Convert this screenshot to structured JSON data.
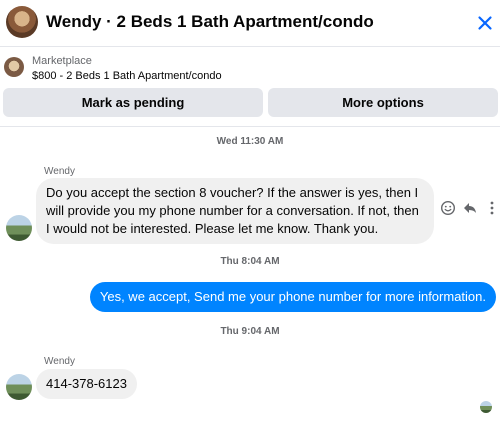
{
  "header": {
    "title": "Wendy · 2 Beds 1 Bath Apartment/condo"
  },
  "marketplace": {
    "label": "Marketplace",
    "listing": "$800 - 2 Beds 1 Bath Apartment/condo",
    "mark_pending_label": "Mark as pending",
    "more_options_label": "More options"
  },
  "conversation": {
    "timestamp_1": "Wed 11:30 AM",
    "sender_1": "Wendy",
    "message_1": "Do you accept the section 8 voucher? If the answer is yes, then I will provide you my phone number for a conversation. If not, then I would not be interested. Please let me know. Thank you.",
    "timestamp_2": "Thu 8:04 AM",
    "message_2": "Yes, we accept, Send me your phone number for more information.",
    "timestamp_3": "Thu 9:04 AM",
    "sender_3": "Wendy",
    "message_3": "414-378-6123"
  },
  "icons": {
    "close": "close-icon",
    "react": "smiley-icon",
    "reply": "reply-icon",
    "more": "more-dots-icon"
  },
  "colors": {
    "outgoing_bubble": "#0084ff",
    "incoming_bubble": "#f0f0f0",
    "button_bg": "#e4e6eb",
    "secondary_text": "#65676b"
  }
}
